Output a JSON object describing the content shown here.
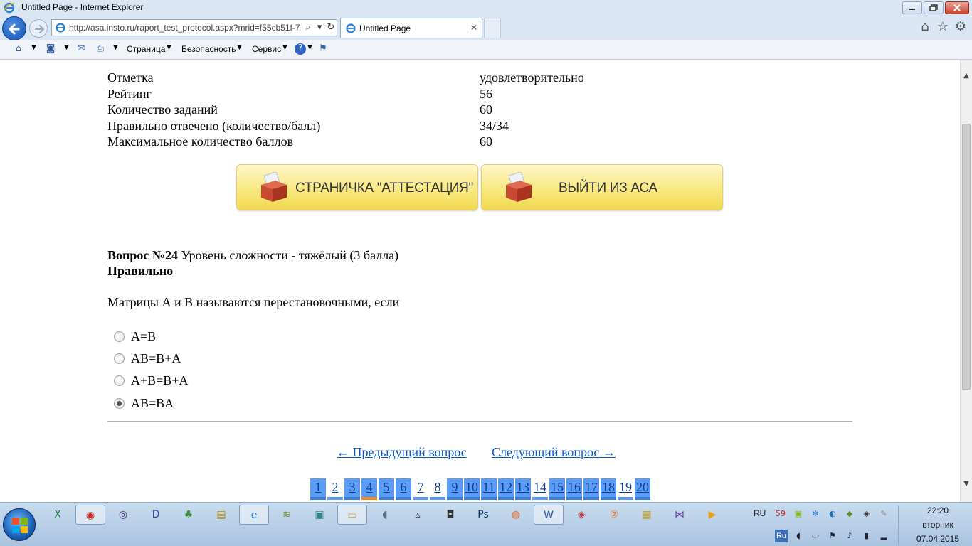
{
  "window": {
    "title": "Untitled Page - Internet Explorer"
  },
  "browser": {
    "address": "http://asa.insto.ru/raport_test_protocol.aspx?mrid=f55cb51f-7",
    "tab_title": "Untitled Page",
    "commands": {
      "page": "Страница",
      "safety": "Безопасность",
      "service": "Сервис"
    }
  },
  "summary": [
    {
      "label": "Отметка",
      "value": "удовлетворительно"
    },
    {
      "label": "Рейтинг",
      "value": "56"
    },
    {
      "label": "Количество заданий",
      "value": "60"
    },
    {
      "label": "Правильно отвечено (количество/балл)",
      "value": "34/34"
    },
    {
      "label": "Максимальное количество баллов",
      "value": "60"
    }
  ],
  "buttons": {
    "attestation": "СТРАНИЧКА \"АТТЕСТАЦИЯ\"",
    "exit": "ВЫЙТИ ИЗ АСА"
  },
  "question": {
    "number_label": "Вопрос №24",
    "difficulty": " Уровень сложности - тяжёлый (3 балла)",
    "status": "Правильно",
    "text": "Матрицы А и В называются перестановочными, если",
    "options": [
      {
        "label": "A=B",
        "checked": false
      },
      {
        "label": "AB=B+A",
        "checked": false
      },
      {
        "label": "A+B=B+A",
        "checked": false
      },
      {
        "label": "AB=BA",
        "checked": true
      }
    ]
  },
  "navigation": {
    "prev": "← Предыдущий вопрос",
    "next": "Следующий вопрос →"
  },
  "pager": {
    "pages": [
      "1",
      "2",
      "3",
      "4",
      "5",
      "6",
      "7",
      "8",
      "9",
      "10",
      "11",
      "12",
      "13",
      "14",
      "15",
      "16",
      "17",
      "18",
      "19",
      "20"
    ],
    "current": "4",
    "highlighted": [
      "1",
      "3",
      "4",
      "5",
      "6",
      "9",
      "10",
      "11",
      "12",
      "13",
      "15",
      "16",
      "17",
      "18",
      "20"
    ]
  },
  "taskbar": {
    "lang_top": "RU",
    "lang_bottom": "Ru",
    "tray_badge": "59",
    "time": "22:20",
    "weekday": "вторник",
    "date": "07.04.2015"
  },
  "colors": {
    "link": "#0b57c7",
    "pager_done": "#5b9cf4",
    "pager_current_marker": "#f08a24",
    "button_yellow": "#f8e77c"
  }
}
